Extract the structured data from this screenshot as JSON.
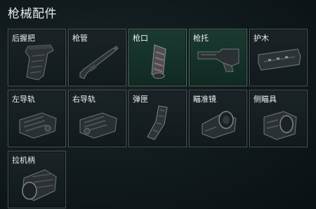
{
  "header": {
    "title": "枪械配件"
  },
  "slots": [
    {
      "label": "后握把",
      "icon": "grip-icon",
      "selected": false
    },
    {
      "label": "枪管",
      "icon": "barrel-icon",
      "selected": false
    },
    {
      "label": "枪口",
      "icon": "muzzle-icon",
      "selected": true
    },
    {
      "label": "枪托",
      "icon": "stock-icon",
      "selected": true
    },
    {
      "label": "护木",
      "icon": "handguard-icon",
      "selected": false
    },
    {
      "label": "左导轨",
      "icon": "left-rail-icon",
      "selected": false
    },
    {
      "label": "右导轨",
      "icon": "right-rail-icon",
      "selected": false
    },
    {
      "label": "弹匣",
      "icon": "magazine-icon",
      "selected": false
    },
    {
      "label": "瞄准镜",
      "icon": "scope-icon",
      "selected": false
    },
    {
      "label": "侧瞄具",
      "icon": "side-sight-icon",
      "selected": false
    },
    {
      "label": "拉机柄",
      "icon": "charging-handle-icon",
      "selected": false
    }
  ]
}
